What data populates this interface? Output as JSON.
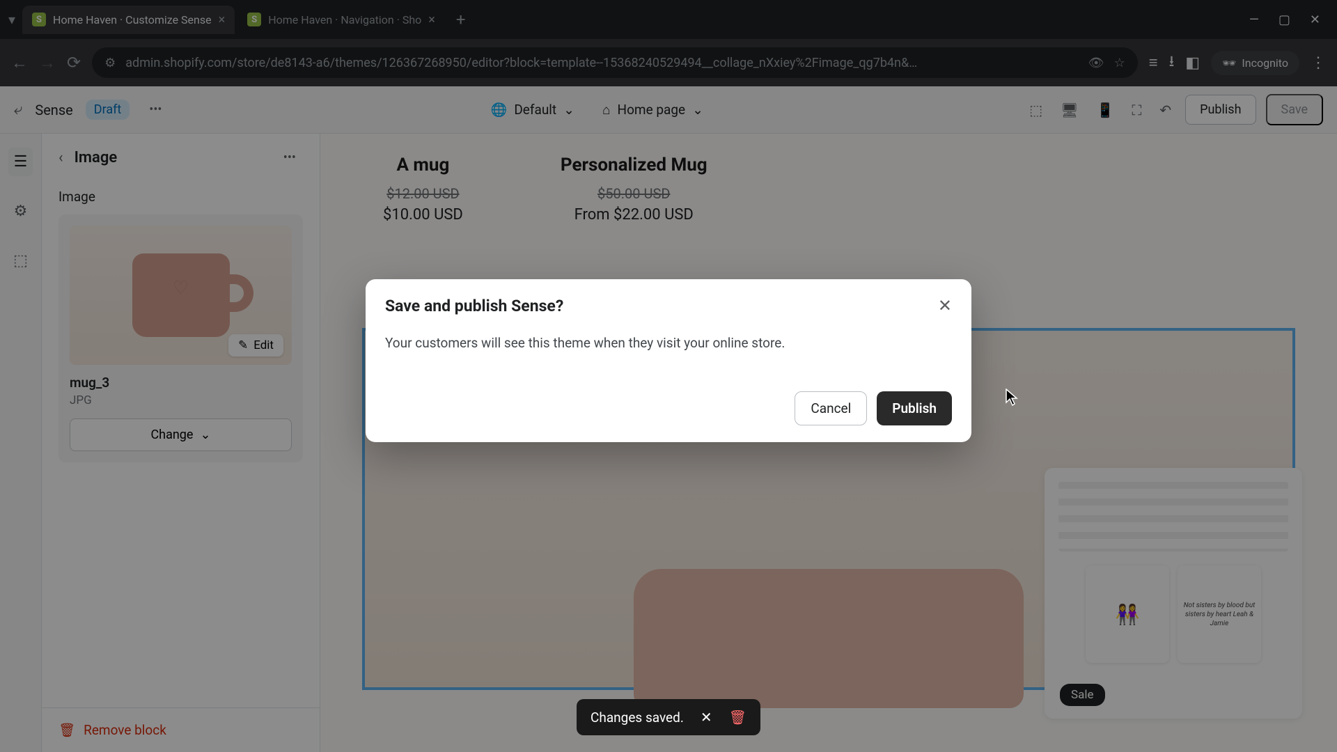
{
  "browser": {
    "tabs": [
      {
        "title": "Home Haven · Customize Sense",
        "active": true
      },
      {
        "title": "Home Haven · Navigation · Sho",
        "active": false
      }
    ],
    "url": "admin.shopify.com/store/de8143-a6/themes/126367268950/editor?block=template--15368240529494__collage_nXxiey%2Fimage_qg7b4n&…",
    "incognito_label": "Incognito"
  },
  "appbar": {
    "theme_name": "Sense",
    "draft_badge": "Draft",
    "template_selector": "Default",
    "page_selector": "Home page",
    "publish_label": "Publish",
    "save_label": "Save"
  },
  "sidebar": {
    "title": "Image",
    "field_label": "Image",
    "edit_label": "Edit",
    "image_name": "mug_3",
    "image_ext": "JPG",
    "change_label": "Change",
    "remove_label": "Remove block"
  },
  "canvas": {
    "products": [
      {
        "title": "A mug",
        "old": "$12.00 USD",
        "new": "$10.00 USD"
      },
      {
        "title": "Personalized Mug",
        "old": "$50.00 USD",
        "new": "From $22.00 USD"
      }
    ],
    "side_text1": "",
    "side_text2": "Not sisters by blood but sisters by heart Leah & Jamie",
    "sale_badge": "Sale"
  },
  "modal": {
    "title": "Save and publish Sense?",
    "body": "Your customers will see this theme when they visit your online store.",
    "cancel": "Cancel",
    "publish": "Publish"
  },
  "toast": {
    "message": "Changes saved."
  }
}
